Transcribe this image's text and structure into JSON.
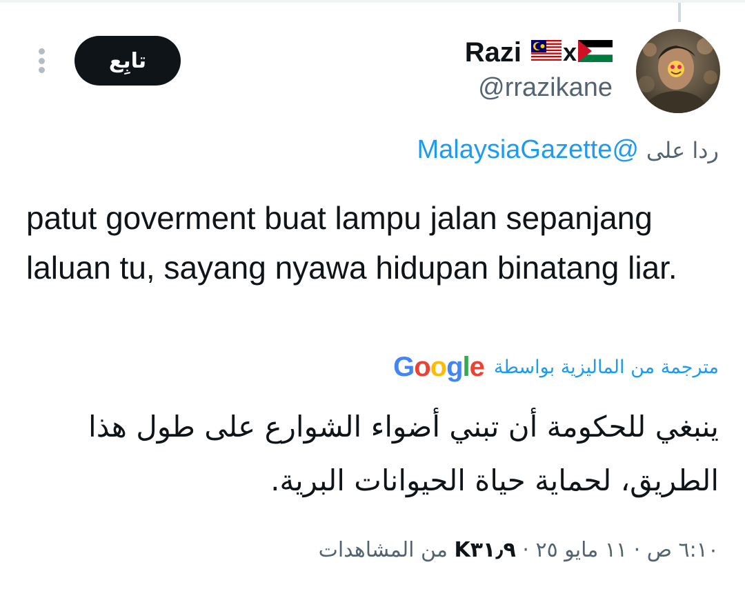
{
  "tweet": {
    "author": {
      "display_name": "Razi",
      "flags": [
        "malaysia-flag",
        "palestine-flag"
      ],
      "flag_separator": "x",
      "handle": "@rrazikane",
      "avatar_icon": "avatar-photo"
    },
    "follow_label": "تابِع",
    "more_icon": "more-vertical-icon",
    "reply_prefix": "ردا على",
    "reply_to": "@MalaysiaGazette",
    "text": "patut goverment buat lampu jalan sepanjang laluan tu, sayang nyawa hidupan binatang liar.",
    "translated_by_label": "مترجمة من الماليزية بواسطة",
    "translator_logo": "Google",
    "translated_text": "ينبغي للحكومة أن تبني أضواء الشوارع على طول هذا الطريق، لحماية حياة الحيوانات البرية.",
    "time": "٦:١٠ ص",
    "date": "١١ مايو ٢٥",
    "separator": "·",
    "views_count": "K٣١٫٩",
    "views_label": "من المشاهدات"
  },
  "colors": {
    "accent": "#1d9bf0",
    "text_primary": "#0f1419",
    "text_secondary": "#536471",
    "follow_bg": "#0f1419"
  }
}
